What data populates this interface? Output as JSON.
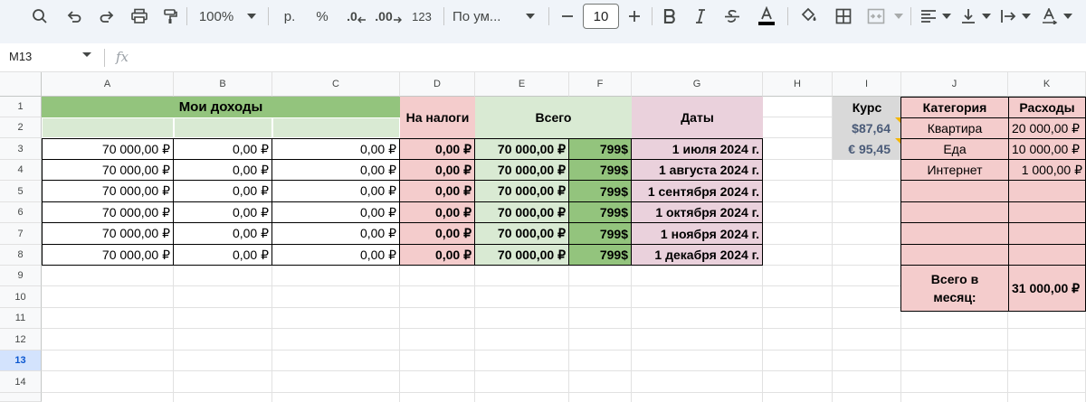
{
  "toolbar": {
    "zoom": "100%",
    "currency": "р.",
    "percent": "%",
    "dec_decrease": ".0",
    "dec_increase": ".00",
    "number_format": "123",
    "font_name": "По ум...",
    "font_size": "10",
    "icons": [
      "search-icon",
      "undo-icon",
      "redo-icon",
      "print-icon",
      "paint-format-icon",
      "bold-icon",
      "italic-icon",
      "strikethrough-icon",
      "text-color-icon",
      "fill-color-icon",
      "borders-icon",
      "merge-cells-icon",
      "align-left-icon",
      "valign-bottom-icon",
      "text-wrap-icon",
      "text-rotation-icon"
    ]
  },
  "formula_bar": {
    "name_box": "M13",
    "fx": "fx",
    "formula": ""
  },
  "columns": [
    "A",
    "B",
    "C",
    "D",
    "E",
    "F",
    "G",
    "H",
    "I",
    "J",
    "K"
  ],
  "rows": [
    "1",
    "2",
    "3",
    "4",
    "5",
    "6",
    "7",
    "8",
    "9",
    "10",
    "11",
    "12",
    "13",
    "14"
  ],
  "active_row": "13",
  "income_table": {
    "title": "Мои доходы",
    "taxes_header": "На налоги",
    "total_header": "Всего",
    "dates_header": "Даты",
    "rows": [
      {
        "a": "70 000,00 ₽",
        "b": "0,00 ₽",
        "c": "0,00 ₽",
        "d": "0,00 ₽",
        "e": "70 000,00 ₽",
        "f": "799$",
        "g": "1 июля 2024 г."
      },
      {
        "a": "70 000,00 ₽",
        "b": "0,00 ₽",
        "c": "0,00 ₽",
        "d": "0,00 ₽",
        "e": "70 000,00 ₽",
        "f": "799$",
        "g": "1 августа 2024 г."
      },
      {
        "a": "70 000,00 ₽",
        "b": "0,00 ₽",
        "c": "0,00 ₽",
        "d": "0,00 ₽",
        "e": "70 000,00 ₽",
        "f": "799$",
        "g": "1 сентября 2024 г."
      },
      {
        "a": "70 000,00 ₽",
        "b": "0,00 ₽",
        "c": "0,00 ₽",
        "d": "0,00 ₽",
        "e": "70 000,00 ₽",
        "f": "799$",
        "g": "1 октября 2024 г."
      },
      {
        "a": "70 000,00 ₽",
        "b": "0,00 ₽",
        "c": "0,00 ₽",
        "d": "0,00 ₽",
        "e": "70 000,00 ₽",
        "f": "799$",
        "g": "1 ноября 2024 г."
      },
      {
        "a": "70 000,00 ₽",
        "b": "0,00 ₽",
        "c": "0,00 ₽",
        "d": "0,00 ₽",
        "e": "70 000,00 ₽",
        "f": "799$",
        "g": "1 декабря 2024 г."
      }
    ]
  },
  "rate_table": {
    "header": "Курс",
    "usd": "$87,64",
    "eur": "€ 95,45"
  },
  "expenses_table": {
    "category_header": "Категория",
    "expenses_header": "Расходы",
    "rows": [
      {
        "category": "Квартира",
        "amount": "20 000,00 ₽"
      },
      {
        "category": "Еда",
        "amount": "10 000,00 ₽"
      },
      {
        "category": "Интернет",
        "amount": "1 000,00 ₽"
      }
    ],
    "total_label": "Всего в месяц:",
    "total_value": "31 000,00 ₽"
  },
  "colors": {
    "green_header": "#93c47d",
    "light_green": "#d9ead3",
    "mid_green": "#b6d7a8",
    "pink": "#f4cccc",
    "lilac": "#ead1dc",
    "gray": "#d9d9d9",
    "rate_text": "#4a5b78"
  }
}
